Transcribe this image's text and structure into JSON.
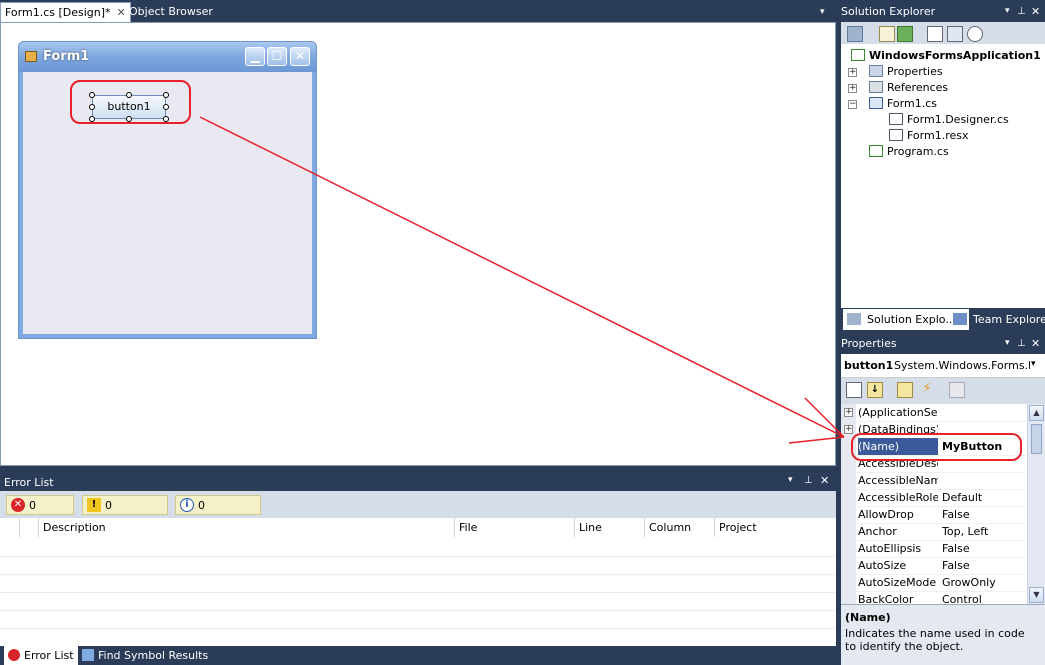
{
  "tabs": {
    "design": "Form1.cs [Design]*",
    "browser": "Object Browser"
  },
  "form": {
    "title": "Form1",
    "button_text": "button1"
  },
  "error_list": {
    "title": "Error List",
    "errors": "0 Errors",
    "warnings": "0 Warnings",
    "messages": "0 Messages",
    "columns": [
      "Description",
      "File",
      "Line",
      "Column",
      "Project"
    ]
  },
  "bottom_tabs": [
    "Error List",
    "Find Symbol Results"
  ],
  "solution_explorer": {
    "title": "Solution Explorer",
    "project": "WindowsFormsApplication1",
    "nodes": [
      "Properties",
      "References",
      "Form1.cs",
      "Form1.Designer.cs",
      "Form1.resx",
      "Program.cs"
    ],
    "tabs": [
      "Solution Explo...",
      "Team Explorer"
    ]
  },
  "properties": {
    "title": "Properties",
    "object_name": "button1",
    "object_type": "System.Windows.Forms.But",
    "rows": [
      {
        "name": "(ApplicationSetti",
        "value": ""
      },
      {
        "name": "(DataBindings)",
        "value": ""
      },
      {
        "name": "(Name)",
        "value": "MyButton"
      },
      {
        "name": "AccessibleDescri",
        "value": ""
      },
      {
        "name": "AccessibleName",
        "value": ""
      },
      {
        "name": "AccessibleRole",
        "value": "Default"
      },
      {
        "name": "AllowDrop",
        "value": "False"
      },
      {
        "name": "Anchor",
        "value": "Top, Left"
      },
      {
        "name": "AutoEllipsis",
        "value": "False"
      },
      {
        "name": "AutoSize",
        "value": "False"
      },
      {
        "name": "AutoSizeMode",
        "value": "GrowOnly"
      },
      {
        "name": "BackColor",
        "value": "Control"
      }
    ],
    "desc_title": "(Name)",
    "desc_text": "Indicates the name used in code to identify the object."
  },
  "colors": {
    "chrome": "#2b3c59",
    "annotation": "#e8202a",
    "selection": "#3a5a9a"
  }
}
